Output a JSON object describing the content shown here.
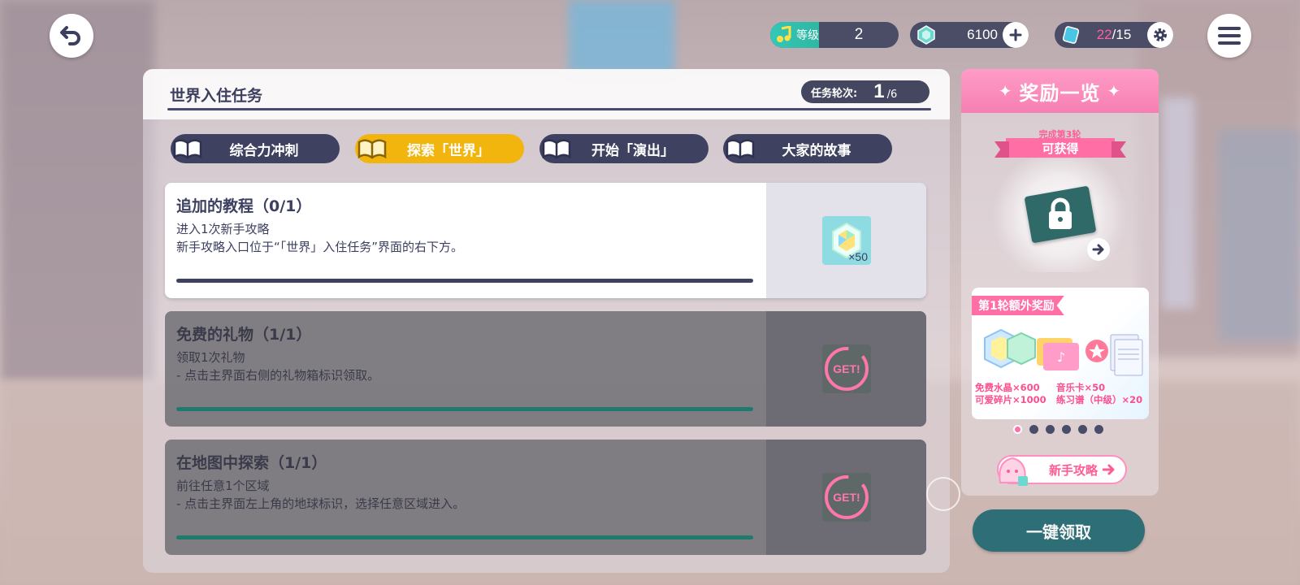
{
  "topbar": {
    "level_label": "等级",
    "level_value": "2",
    "gems": "6100",
    "tickets_current": "22",
    "tickets_max": "/15"
  },
  "panel": {
    "title": "世界入住任务",
    "round_label": "任务轮次:",
    "round_value": "1",
    "round_total": "/6"
  },
  "tabs": [
    {
      "label": "综合力冲刺",
      "active": false
    },
    {
      "label": "探索「世界」",
      "active": true
    },
    {
      "label": "开始「演出」",
      "active": false
    },
    {
      "label": "大家的故事",
      "active": false
    }
  ],
  "tasks": [
    {
      "name": "追加的教程（0/1）",
      "line1": "进入1次新手攻略",
      "line2": "新手攻略入口位于“「世界」入住任务”界面的右下方。",
      "reward_qty": "×50",
      "progress": 0,
      "state": "active"
    },
    {
      "name": "免费的礼物（1/1）",
      "line1": "领取1次礼物",
      "line2": "- 点击主界面右侧的礼物箱标识领取。",
      "reward_badge": "GET!",
      "progress": 1,
      "state": "done"
    },
    {
      "name": "在地图中探索（1/1）",
      "line1": "前往任意1个区域",
      "line2": "- 点击主界面左上角的地球标识，选择任意区域进入。",
      "reward_badge": "GET!",
      "progress": 1,
      "state": "done"
    }
  ],
  "rewards_panel": {
    "title": "奖励一览",
    "ribbon_top": "完成第3轮",
    "ribbon": "可获得",
    "bonus_label": "第1轮额外奖励",
    "bonus_items": [
      "免费水晶×600",
      "音乐卡×50",
      "可爱碎片×1000",
      "练习谱（中级）×20"
    ],
    "page_count": 6,
    "page_active": 0,
    "guide_button": "新手攻略",
    "claim_all": "一键领取"
  },
  "colors": {
    "accent_tab": "#f1b50d",
    "dark_navy": "#3e4160",
    "pink": "#ff6fa6",
    "teal_button": "#2e6e77",
    "done_bar": "#1d7a6c"
  },
  "icons": [
    "back-arrow-icon",
    "music-note-icon",
    "gem-icon",
    "plus-icon",
    "ticket-icon",
    "gear-icon",
    "hamburger-menu-icon",
    "book-icon",
    "lock-icon",
    "arrow-right-icon",
    "get-stamp-icon"
  ]
}
